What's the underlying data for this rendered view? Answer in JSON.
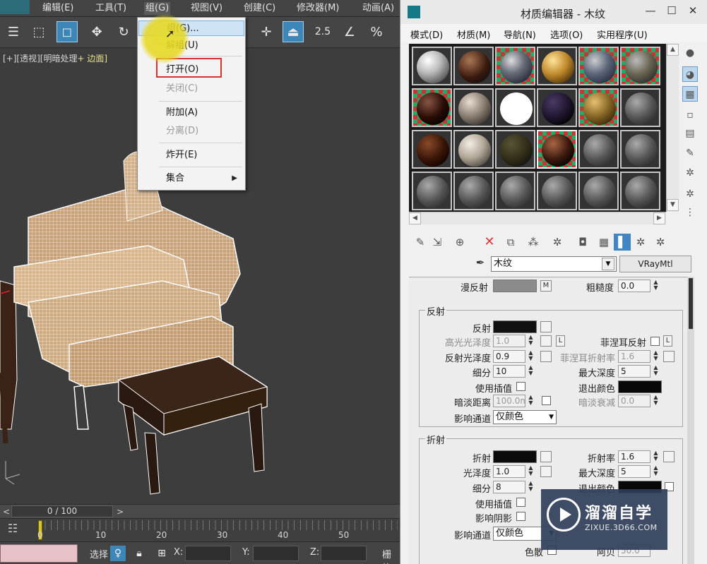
{
  "menubar": {
    "items": [
      "编辑(E)",
      "工具(T)",
      "组(G)",
      "视图(V)",
      "创建(C)",
      "修改器(M)",
      "动画(A)"
    ]
  },
  "toolbar": {
    "snap_2_5": "2.5",
    "angle_snap": "∠",
    "percent_snap": "%"
  },
  "viewport": {
    "label_parts": [
      "[+]",
      "[透视]",
      "[明暗处理",
      "+ 边面]"
    ]
  },
  "group_menu": {
    "items": [
      {
        "label": "组(G)...",
        "enabled": true
      },
      {
        "label": "解组(U)",
        "enabled": true
      },
      {
        "label": "打开(O)",
        "enabled": true
      },
      {
        "label": "关闭(C)",
        "enabled": false
      },
      {
        "label": "附加(A)",
        "enabled": true
      },
      {
        "label": "分离(D)",
        "enabled": false
      },
      {
        "label": "炸开(E)",
        "enabled": true
      },
      {
        "label": "集合",
        "enabled": true
      }
    ]
  },
  "timeline": {
    "frame": "0 / 100",
    "left_arrow": "<",
    "right_arrow": ">",
    "ruler_numbers": [
      "0",
      "10",
      "20",
      "30",
      "40",
      "50"
    ]
  },
  "statusbar": {
    "select_label": "选择",
    "x_label": "X:",
    "y_label": "Y:",
    "z_label": "Z:",
    "grid_label": "栅格"
  },
  "material_editor": {
    "title": "材质编辑器 - 木纹",
    "window_controls": [
      "—",
      "☐",
      "✕"
    ],
    "menu": [
      "模式(D)",
      "材质(M)",
      "导航(N)",
      "选项(O)",
      "实用程序(U)"
    ],
    "material_name": "木纹",
    "material_type": "VRayMtl",
    "diffuse": {
      "label": "漫反射",
      "map_btn": "M",
      "roughness_label": "粗糙度",
      "roughness": "0.0"
    },
    "reflection": {
      "group_title": "反射",
      "reflect_label": "反射",
      "hilight_gloss_label": "高光光泽度",
      "hilight_gloss": "1.0",
      "lock_btn": "L",
      "fresnel_label": "菲涅耳反射",
      "fresnel_lock": "L",
      "refl_gloss_label": "反射光泽度",
      "refl_gloss": "0.9",
      "fresnel_ior_label": "菲涅耳折射率",
      "fresnel_ior": "1.6",
      "subdivs_label": "细分",
      "subdivs": "10",
      "max_depth_label": "最大深度",
      "max_depth": "5",
      "use_interp_label": "使用插值",
      "exit_color_label": "退出颜色",
      "dim_dist_label": "暗淡距离",
      "dim_dist": "100.0m",
      "dim_falloff_label": "暗淡衰减",
      "dim_falloff": "0.0",
      "affect_channels_label": "影响通道",
      "affect_channels": "仅颜色"
    },
    "refraction": {
      "group_title": "折射",
      "refract_label": "折射",
      "ior_label": "折射率",
      "ior": "1.6",
      "gloss_label": "光泽度",
      "gloss": "1.0",
      "max_depth_label": "最大深度",
      "max_depth": "5",
      "subdivs_label": "细分",
      "subdivs": "8",
      "exit_color_label": "退出颜色",
      "use_interp_label": "使用插值",
      "affect_shadows_label": "影响阴影",
      "affect_channels_label": "影响通道",
      "affect_channels": "仅颜色",
      "dispersion_label": "色散",
      "abbe_label": "阿贝",
      "abbe": "50.0"
    }
  },
  "watermark": {
    "text": "溜溜自学",
    "url": "ZIXUE.3D66.COM"
  },
  "colors": {
    "viewport_bg": "#3d3d3d",
    "menu_highlight": "#cfe3f7",
    "open_outline": "#d6322f",
    "cursor_glow": "#e6dc28",
    "active_tool": "#3d86b8"
  }
}
